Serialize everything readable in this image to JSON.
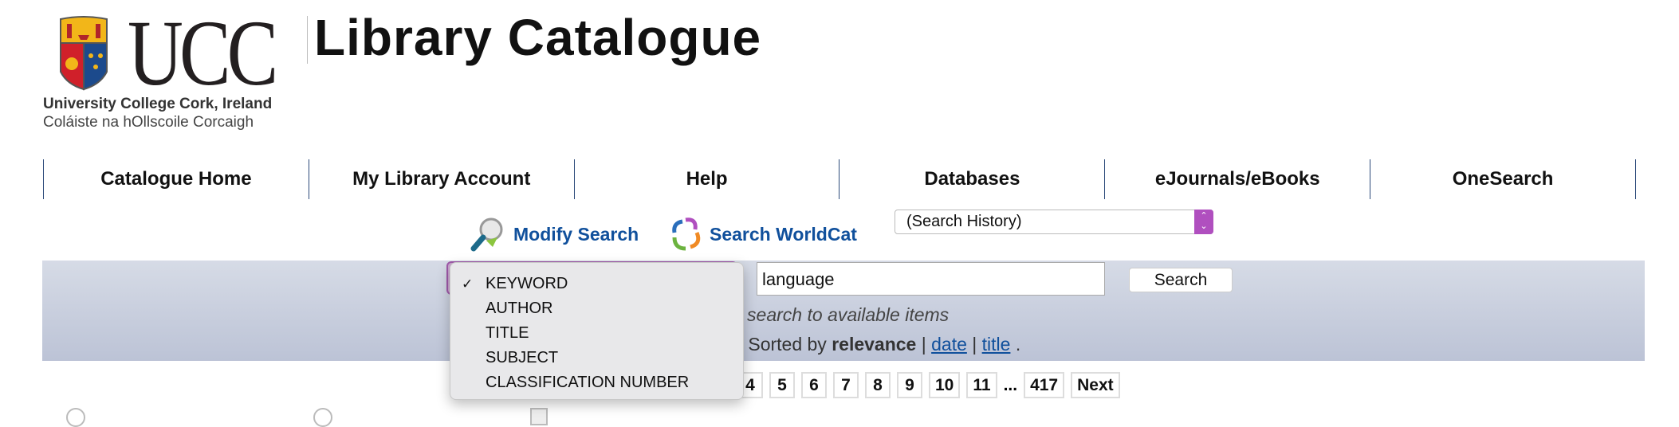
{
  "logo": {
    "name": "UCC",
    "line1": "University College Cork, Ireland",
    "line2": "Coláiste na hOllscoile Corcaigh"
  },
  "header": {
    "title": "Library Catalogue"
  },
  "nav": [
    "Catalogue Home",
    "My Library Account",
    "Help",
    "Databases",
    "eJournals/eBooks",
    "OneSearch"
  ],
  "links": {
    "modify": "Modify Search",
    "worldcat": "Search WorldCat"
  },
  "history_select": {
    "value": "(Search History)"
  },
  "search": {
    "query": "language",
    "button": "Search",
    "limit_text": "mit search to available items",
    "sort_prefix": "nd. Sorted by ",
    "sort_current": "relevance",
    "sort_date": "date",
    "sort_title": "title"
  },
  "dropdown": {
    "selected": "KEYWORD",
    "options": [
      "KEYWORD",
      "AUTHOR",
      "TITLE",
      "SUBJECT",
      "CLASSIFICATION NUMBER"
    ]
  },
  "pager": {
    "pages": [
      "4",
      "5",
      "6",
      "7",
      "8",
      "9",
      "10",
      "11"
    ],
    "ellipsis": "...",
    "last": "417",
    "next": "Next"
  },
  "colors": {
    "link": "#10509c",
    "band": "#c8cedd",
    "accent": "#b04fbf"
  }
}
